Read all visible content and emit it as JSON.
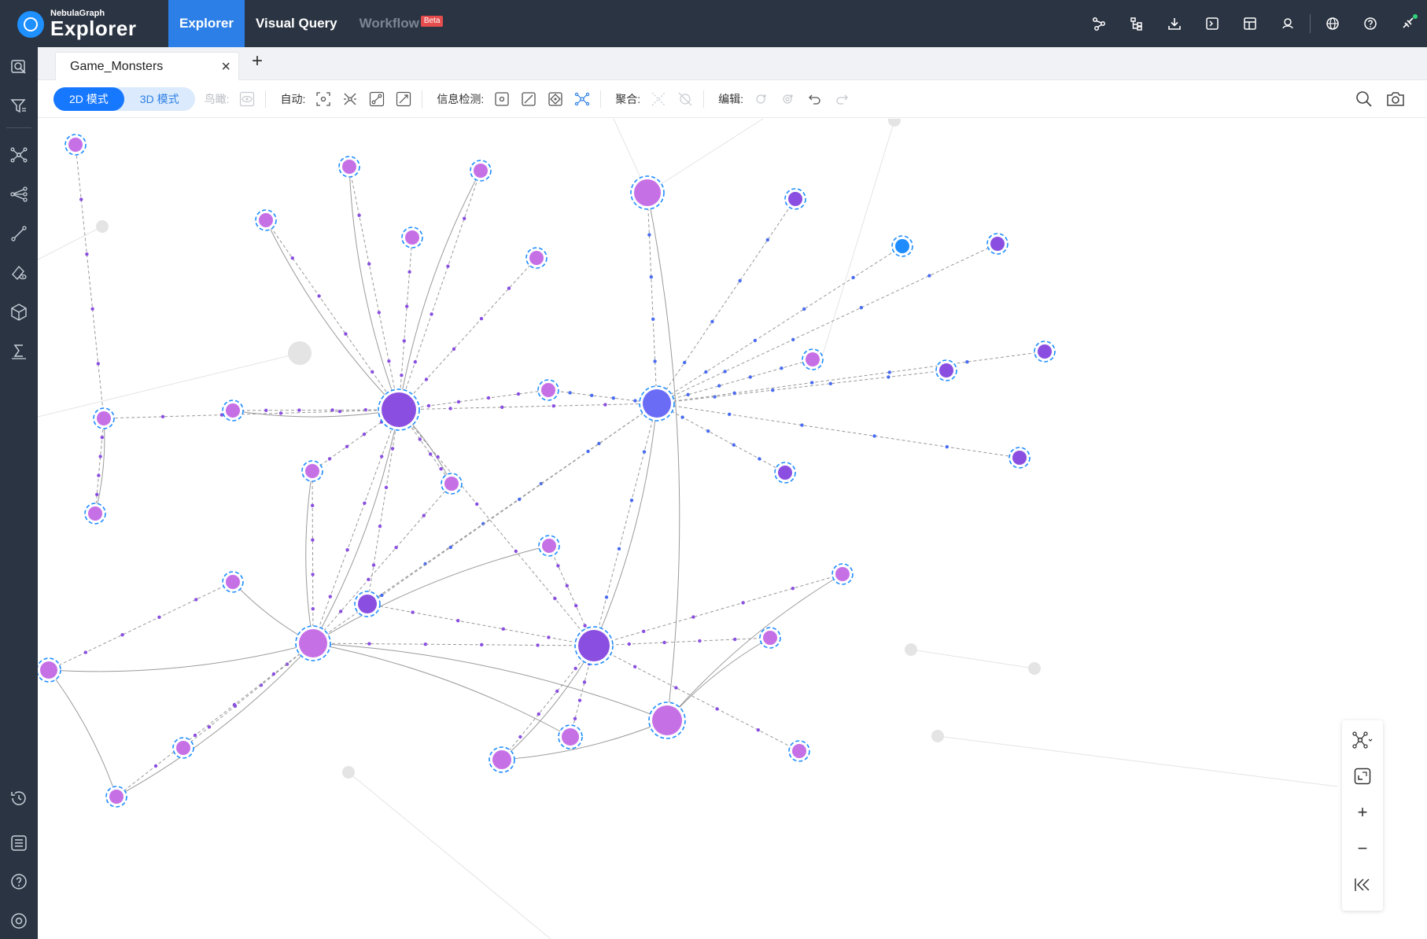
{
  "app": {
    "brand_small": "NebulaGraph",
    "brand_big": "Explorer"
  },
  "nav": [
    {
      "label": "Explorer",
      "active": true
    },
    {
      "label": "Visual Query",
      "active": false
    },
    {
      "label": "Workflow",
      "active": false,
      "badge": "Beta"
    }
  ],
  "top_icons": [
    "schema-icon",
    "tree-icon",
    "download-icon",
    "console-icon",
    "layout-icon",
    "user-group-icon",
    "language-globe-icon",
    "help-icon",
    "connection-icon"
  ],
  "sidebar_icons": [
    "search-query-icon",
    "filter-icon",
    "expand-icon",
    "common-neighbor-icon",
    "path-icon",
    "property-view-icon",
    "graph-3d-icon",
    "statistics-icon",
    "history-icon",
    "list-icon",
    "help-icon",
    "settings-icon"
  ],
  "tab": {
    "label": "Game_Monsters",
    "close": "×",
    "add": "+"
  },
  "toolbar": {
    "mode_2d": "2D 模式",
    "mode_3d": "3D 模式",
    "birdseye": "鸟瞰:",
    "auto": "自动:",
    "detect": "信息检测:",
    "aggregate": "聚合:",
    "edit": "编辑:"
  },
  "zoom": {
    "layout": "layout-icon",
    "fit": "fit-view-icon",
    "zoom_in": "+",
    "zoom_out": "−",
    "collapse": "collapse-icon"
  },
  "colors": {
    "topbar": "#2b3442",
    "accent": "#2b7fe6",
    "node_purple": "#8a4fe0",
    "node_violet": "#c670e6",
    "node_blue": "#1e8cff",
    "node_indigo": "#6a6cf5",
    "edge": "#9a9a9a",
    "faded": "#e4e4e4"
  },
  "graph": {
    "hub_a": {
      "id": "A",
      "color": "purple"
    },
    "hub_b": {
      "id": "B",
      "color": "indigo"
    },
    "hub_c": {
      "id": "C",
      "color": "purple"
    },
    "hub_d": {
      "id": "D",
      "color": "violet"
    },
    "hub_e": {
      "id": "E",
      "color": "violet"
    },
    "hub_f": {
      "id": "F",
      "color": "violet"
    }
  }
}
